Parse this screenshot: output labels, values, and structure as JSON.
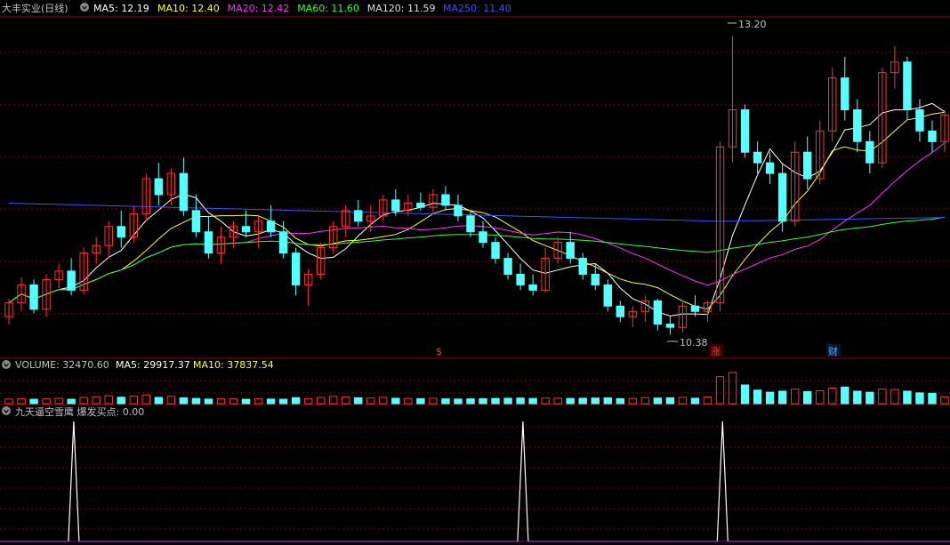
{
  "header": {
    "title": "大丰实业(日线)",
    "ma_labels": [
      {
        "text": "MA5: 12.19",
        "color": "#ffffff"
      },
      {
        "text": "MA10: 12.40",
        "color": "#ffff33"
      },
      {
        "text": "MA20: 12.42",
        "color": "#ff33ff"
      },
      {
        "text": "MA60: 11.60",
        "color": "#33ff33"
      },
      {
        "text": "MA120: 11.59",
        "color": "#dddddd"
      },
      {
        "text": "MA250: 11.40",
        "color": "#3355ff"
      }
    ]
  },
  "volume_header": {
    "label": "VOLUME: 32470.60",
    "ma5": "MA5: 29917.37",
    "ma10": "MA10: 37837.54"
  },
  "indicator_header": {
    "label": "九天逼空雪鹰  爆发买点: 0.00"
  },
  "annotations": {
    "high_label": "13.20",
    "low_label": "10.38",
    "marker_dollar": "$",
    "marker_zhang": "涨",
    "marker_cai": "财"
  },
  "colors": {
    "up": "#ff3232",
    "down": "#54ffff",
    "grid": "#8b0000",
    "text_gray": "#c0c0c0"
  },
  "chart_data": [
    {
      "type": "candlestick",
      "title": "大丰实业(日线)",
      "ylim": [
        10.2,
        13.35
      ],
      "ohlc": [
        [
          10.55,
          10.72,
          10.48,
          10.68
        ],
        [
          10.68,
          10.92,
          10.6,
          10.85
        ],
        [
          10.85,
          10.9,
          10.58,
          10.62
        ],
        [
          10.62,
          10.95,
          10.55,
          10.9
        ],
        [
          10.9,
          11.05,
          10.82,
          10.98
        ],
        [
          10.98,
          11.1,
          10.75,
          10.8
        ],
        [
          10.8,
          11.2,
          10.76,
          11.15
        ],
        [
          11.15,
          11.3,
          11.05,
          11.22
        ],
        [
          11.22,
          11.45,
          11.1,
          11.4
        ],
        [
          11.4,
          11.55,
          11.2,
          11.3
        ],
        [
          11.3,
          11.6,
          11.25,
          11.52
        ],
        [
          11.52,
          11.9,
          11.45,
          11.85
        ],
        [
          11.85,
          12.0,
          11.6,
          11.7
        ],
        [
          11.7,
          11.95,
          11.6,
          11.9
        ],
        [
          11.9,
          12.05,
          11.5,
          11.55
        ],
        [
          11.55,
          11.7,
          11.3,
          11.35
        ],
        [
          11.35,
          11.5,
          11.1,
          11.15
        ],
        [
          11.15,
          11.4,
          11.05,
          11.3
        ],
        [
          11.3,
          11.45,
          11.2,
          11.4
        ],
        [
          11.4,
          11.55,
          11.3,
          11.35
        ],
        [
          11.35,
          11.5,
          11.2,
          11.45
        ],
        [
          11.45,
          11.6,
          11.3,
          11.35
        ],
        [
          11.35,
          11.45,
          11.1,
          11.15
        ],
        [
          11.15,
          11.2,
          10.75,
          10.85
        ],
        [
          10.85,
          11.0,
          10.65,
          10.95
        ],
        [
          10.95,
          11.25,
          10.9,
          11.2
        ],
        [
          11.2,
          11.45,
          11.15,
          11.4
        ],
        [
          11.4,
          11.6,
          11.3,
          11.55
        ],
        [
          11.55,
          11.65,
          11.4,
          11.45
        ],
        [
          11.45,
          11.6,
          11.35,
          11.5
        ],
        [
          11.5,
          11.7,
          11.45,
          11.65
        ],
        [
          11.65,
          11.75,
          11.5,
          11.55
        ],
        [
          11.55,
          11.7,
          11.5,
          11.62
        ],
        [
          11.62,
          11.72,
          11.55,
          11.58
        ],
        [
          11.58,
          11.75,
          11.52,
          11.7
        ],
        [
          11.7,
          11.78,
          11.55,
          11.6
        ],
        [
          11.6,
          11.7,
          11.45,
          11.5
        ],
        [
          11.5,
          11.55,
          11.3,
          11.35
        ],
        [
          11.35,
          11.45,
          11.2,
          11.25
        ],
        [
          11.25,
          11.3,
          11.05,
          11.1
        ],
        [
          11.1,
          11.15,
          10.9,
          10.95
        ],
        [
          10.95,
          11.05,
          10.8,
          10.85
        ],
        [
          10.85,
          10.95,
          10.75,
          10.8
        ],
        [
          10.8,
          11.2,
          10.78,
          11.1
        ],
        [
          11.1,
          11.3,
          11.05,
          11.25
        ],
        [
          11.25,
          11.35,
          11.05,
          11.1
        ],
        [
          11.1,
          11.15,
          10.9,
          10.95
        ],
        [
          10.95,
          11.05,
          10.8,
          10.85
        ],
        [
          10.85,
          10.9,
          10.6,
          10.65
        ],
        [
          10.65,
          10.7,
          10.5,
          10.55
        ],
        [
          10.55,
          10.65,
          10.45,
          10.6
        ],
        [
          10.6,
          10.75,
          10.5,
          10.7
        ],
        [
          10.7,
          10.72,
          10.42,
          10.48
        ],
        [
          10.48,
          10.55,
          10.38,
          10.45
        ],
        [
          10.45,
          10.7,
          10.4,
          10.65
        ],
        [
          10.65,
          10.75,
          10.55,
          10.6
        ],
        [
          10.6,
          10.7,
          10.5,
          10.68
        ],
        [
          10.68,
          12.2,
          10.6,
          12.15
        ],
        [
          12.15,
          13.2,
          12.0,
          12.5
        ],
        [
          12.5,
          12.55,
          12.05,
          12.1
        ],
        [
          12.1,
          12.2,
          11.9,
          12.0
        ],
        [
          12.0,
          12.1,
          11.8,
          11.9
        ],
        [
          11.9,
          12.0,
          11.35,
          11.45
        ],
        [
          11.45,
          12.2,
          11.4,
          12.1
        ],
        [
          12.1,
          12.25,
          11.75,
          11.85
        ],
        [
          11.85,
          12.4,
          11.8,
          12.3
        ],
        [
          12.3,
          12.9,
          12.2,
          12.8
        ],
        [
          12.8,
          13.0,
          12.4,
          12.5
        ],
        [
          12.5,
          12.6,
          12.1,
          12.2
        ],
        [
          12.2,
          12.3,
          11.9,
          12.0
        ],
        [
          12.0,
          12.9,
          11.95,
          12.85
        ],
        [
          12.85,
          13.1,
          12.7,
          12.95
        ],
        [
          12.95,
          13.0,
          12.4,
          12.5
        ],
        [
          12.5,
          12.6,
          12.2,
          12.3
        ],
        [
          12.3,
          12.4,
          12.1,
          12.2
        ],
        [
          12.2,
          12.5,
          12.1,
          12.45
        ]
      ]
    },
    {
      "type": "bar",
      "title": "VOLUME",
      "values": [
        22000,
        24000,
        21000,
        23000,
        26000,
        21000,
        30000,
        33000,
        38000,
        31000,
        36000,
        42000,
        30000,
        35000,
        28000,
        25000,
        22000,
        24000,
        23000,
        21000,
        24000,
        22000,
        21000,
        29000,
        24000,
        30000,
        35000,
        33000,
        28000,
        27000,
        30000,
        26000,
        25000,
        24000,
        26000,
        23000,
        22000,
        23000,
        24000,
        25000,
        26000,
        27000,
        25000,
        27000,
        26000,
        25000,
        26000,
        27000,
        28000,
        24000,
        25000,
        29000,
        27000,
        28000,
        30000,
        26000,
        32000,
        130000,
        150000,
        90000,
        65000,
        55000,
        60000,
        70000,
        58000,
        62000,
        75000,
        80000,
        60000,
        55000,
        70000,
        68000,
        60000,
        52000,
        50000,
        32470
      ]
    },
    {
      "type": "line",
      "title": "九天逼空雪鹰  爆发买点",
      "x_index": [
        0,
        1,
        2,
        3,
        4,
        5,
        6,
        7,
        8,
        9,
        10,
        11,
        12,
        13,
        14,
        15,
        16,
        17,
        18,
        19,
        20,
        21,
        22,
        23,
        24,
        25,
        26,
        27,
        28,
        29,
        30,
        31,
        32,
        33,
        34,
        35,
        36,
        37,
        38,
        39,
        40,
        41,
        42,
        43,
        44,
        45,
        46,
        47,
        48,
        49,
        50,
        51,
        52,
        53,
        54,
        55,
        56,
        57,
        58,
        59,
        60,
        61,
        62,
        63,
        64,
        65,
        66,
        67,
        68,
        69,
        70,
        71,
        72,
        73,
        74,
        75
      ],
      "spikes_at_index": [
        5,
        41,
        57
      ],
      "values": "0 everywhere except 1 at spike indices",
      "last_value": 0.0
    }
  ]
}
